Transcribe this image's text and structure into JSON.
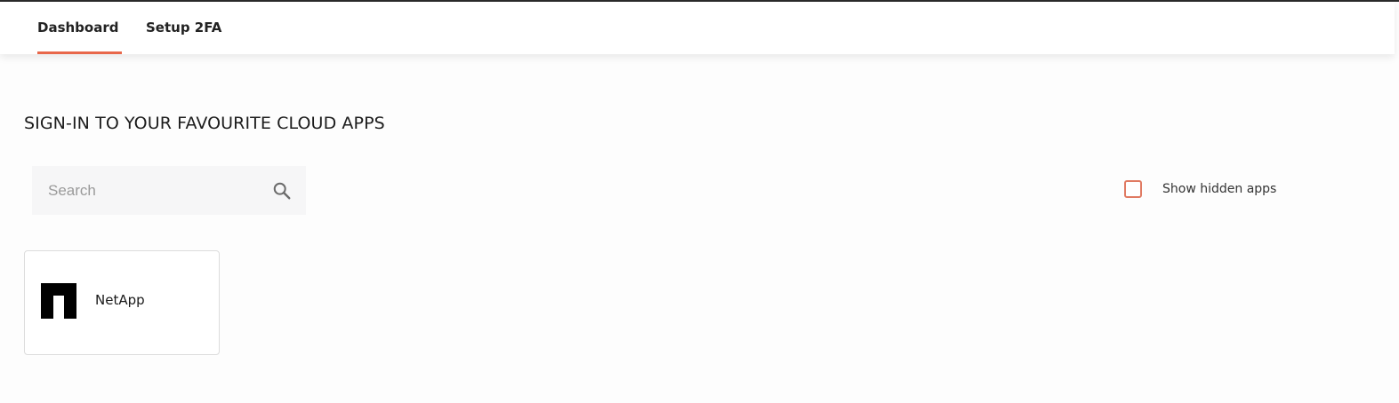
{
  "nav": {
    "tabs": [
      {
        "label": "Dashboard",
        "active": true
      },
      {
        "label": "Setup 2FA",
        "active": false
      }
    ],
    "accent_color": "#e8674a"
  },
  "main": {
    "heading": "SIGN-IN TO YOUR FAVOURITE CLOUD APPS",
    "search": {
      "placeholder": "Search",
      "value": "",
      "icon": "search-icon"
    },
    "show_hidden": {
      "label": "Show hidden apps",
      "checked": false
    },
    "apps": [
      {
        "name": "NetApp",
        "icon": "netapp-logo-icon"
      }
    ]
  }
}
